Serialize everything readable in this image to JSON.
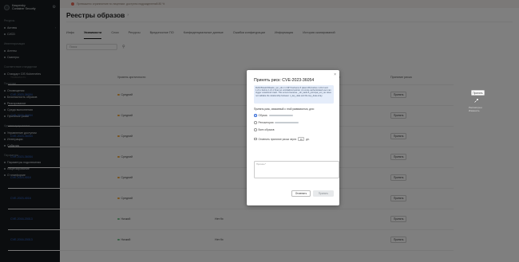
{
  "brand": {
    "line1": "Kaspersky",
    "line2": "Container Security"
  },
  "notice": "Превышено ограничение по лицензии: доступно подразделений 80 %",
  "sidebar": {
    "sections": [
      {
        "title": "Ресурсы",
        "items": [
          {
            "label": "Активы"
          },
          {
            "label": "CI/CD"
          }
        ]
      },
      {
        "title": "Инвентаризация",
        "items": [
          {
            "label": "Агенты"
          },
          {
            "label": "Сканеры"
          }
        ]
      },
      {
        "title": "Соответствие стандартам",
        "items": [
          {
            "label": "Стандарт CIS Kubernetes"
          }
        ]
      },
      {
        "title": "Политики",
        "items": [
          {
            "label": "Оповещения"
          },
          {
            "label": "Безопасность образов"
          },
          {
            "label": "Реагирование"
          },
          {
            "label": "Среда выполнения"
          },
          {
            "label": "Принятые риски"
          }
        ]
      },
      {
        "title": "Администрирование",
        "items": [
          {
            "label": "Управление доступом"
          },
          {
            "label": "Интеграции"
          },
          {
            "label": "События"
          }
        ]
      },
      {
        "title": "Параметры",
        "items": [
          {
            "label": "Параметры подключения"
          },
          {
            "label": "Лицензирование"
          },
          {
            "label": "О платформе"
          }
        ]
      }
    ]
  },
  "page": {
    "title": "Реестры образов",
    "search_placeholder": "Поиск"
  },
  "tabs": [
    {
      "label": "Инфо"
    },
    {
      "label": "Уязвимости"
    },
    {
      "label": "Слои"
    },
    {
      "label": "Ресурсы"
    },
    {
      "label": "Вредоносное ПО"
    },
    {
      "label": "Конфиденциальные данные"
    },
    {
      "label": "Ошибки конфигурации"
    },
    {
      "label": "Информация"
    },
    {
      "label": "История сканирований"
    }
  ],
  "table": {
    "columns": [
      "Уязвимость",
      "Уровень критичности",
      "",
      "Исправлено производителем",
      "Принятие риска"
    ],
    "rows": [
      {
        "cve": "CVE-2023-36054",
        "severity": "Средний",
        "extra": "",
        "fixed": "✓",
        "accept": "Принять"
      },
      {
        "cve": "CVE-2023-36054",
        "severity": "Средний",
        "extra": "",
        "fixed": "✓",
        "accept": "Принять"
      },
      {
        "cve": "CVE-2023-36054",
        "severity": "Средний",
        "extra": "",
        "fixed": "✓",
        "accept": "Принять"
      },
      {
        "cve": "CVE-2023-36054",
        "severity": "Средний",
        "extra": "",
        "fixed": "✓",
        "accept": "Принять"
      },
      {
        "cve": "CVE-2023-4016",
        "severity": "Средний",
        "extra": "",
        "fixed": "✓",
        "accept": "Принять"
      },
      {
        "cve": "CVE-2023-4016",
        "severity": "Средний",
        "extra": "",
        "fixed": "✓",
        "accept": "Принять"
      },
      {
        "cve": "CVE-2016-20013",
        "severity": "Низкий",
        "extra": "Нет fix",
        "fixed": "",
        "accept": "Принять"
      },
      {
        "cve": "CVE-2016-20013",
        "severity": "Низкий",
        "extra": "Нет fix",
        "fixed": "",
        "accept": "Принять"
      }
    ]
  },
  "highlight_accept": {
    "label": "Принять",
    "tooltip": "Рассмотрен Изменить"
  },
  "modal": {
    "title": "Принять риск: CVE-2023-36054",
    "info": "lib/krb5/kadm5/kadm_rpc_xdr.c in MIT Kerberos 5 (aka krb5) before 1.20.2 and 1.21.x before 1.21.1 frees an uninitialized pointer. A remote authenticated user can trigger a kadmind crash. This occurs because _xdr_kadm5_principal_ent_rec does not validate the relationship between n_key_data and the key_data array.",
    "question": "Принять риск, связанный с этой уязвимостью, для:",
    "options": [
      "Образа",
      "Репозитория",
      "Всех образов"
    ],
    "checkbox_label": "Отменить принятие риска через",
    "days_value": "30",
    "days_unit": "дн.",
    "reason_placeholder": "Причина *",
    "cancel": "Отменить",
    "apply": "Принять"
  }
}
